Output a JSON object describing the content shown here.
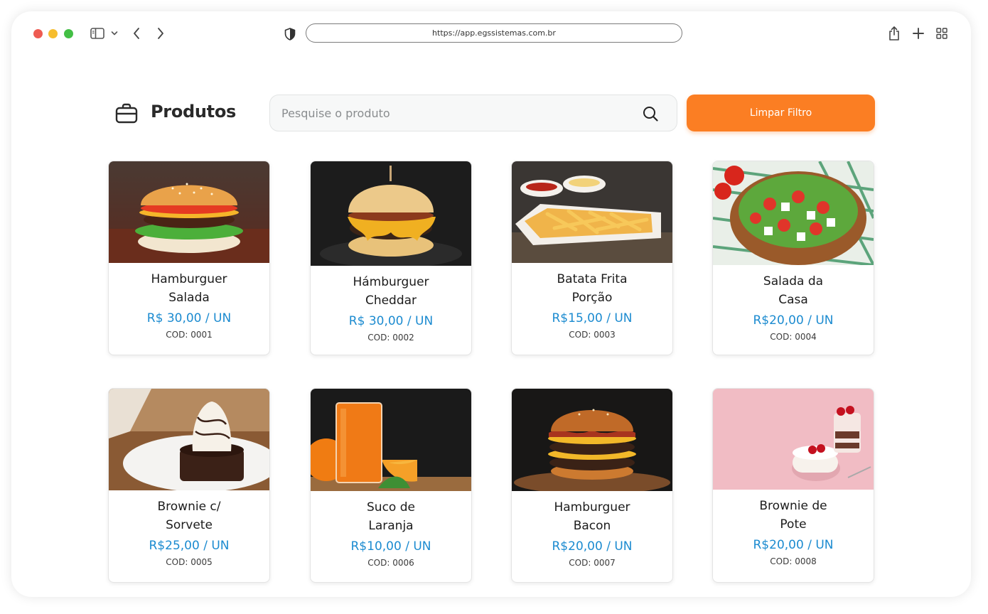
{
  "browser": {
    "url": "https://app.egssistemas.com.br"
  },
  "page": {
    "title": "Produtos",
    "search_placeholder": "Pesquise o produto",
    "search_value": "",
    "clear_filter_label": "Limpar Filtro"
  },
  "colors": {
    "accent": "#fb7e23",
    "price": "#1c8bd0"
  },
  "products": [
    {
      "name_line1": "Hamburguer",
      "name_line2": "Salada",
      "price": "R$ 30,00 / UN",
      "code": "COD: 0001",
      "image": "hamburger-salad-photo"
    },
    {
      "name_line1": "Hámburguer",
      "name_line2": "Cheddar",
      "price": "R$ 30,00 / UN",
      "code": "COD: 0002",
      "image": "cheddar-burger-photo"
    },
    {
      "name_line1": "Batata Frita",
      "name_line2": "Porção",
      "price": "R$15,00 / UN",
      "code": "COD: 0003",
      "image": "french-fries-photo"
    },
    {
      "name_line1": "Salada da",
      "name_line2": "Casa",
      "price": "R$20,00 / UN",
      "code": "COD: 0004",
      "image": "house-salad-photo"
    },
    {
      "name_line1": "Brownie c/",
      "name_line2": "Sorvete",
      "price": "R$25,00 / UN",
      "code": "COD: 0005",
      "image": "brownie-ice-cream-photo"
    },
    {
      "name_line1": "Suco de",
      "name_line2": "Laranja",
      "price": "R$10,00 / UN",
      "code": "COD: 0006",
      "image": "orange-juice-photo"
    },
    {
      "name_line1": "Hamburguer",
      "name_line2": "Bacon",
      "price": "R$20,00 / UN",
      "code": "COD: 0007",
      "image": "bacon-burger-photo"
    },
    {
      "name_line1": "Brownie de",
      "name_line2": "Pote",
      "price": "R$20,00 / UN",
      "code": "COD: 0008",
      "image": "brownie-jar-photo"
    }
  ]
}
